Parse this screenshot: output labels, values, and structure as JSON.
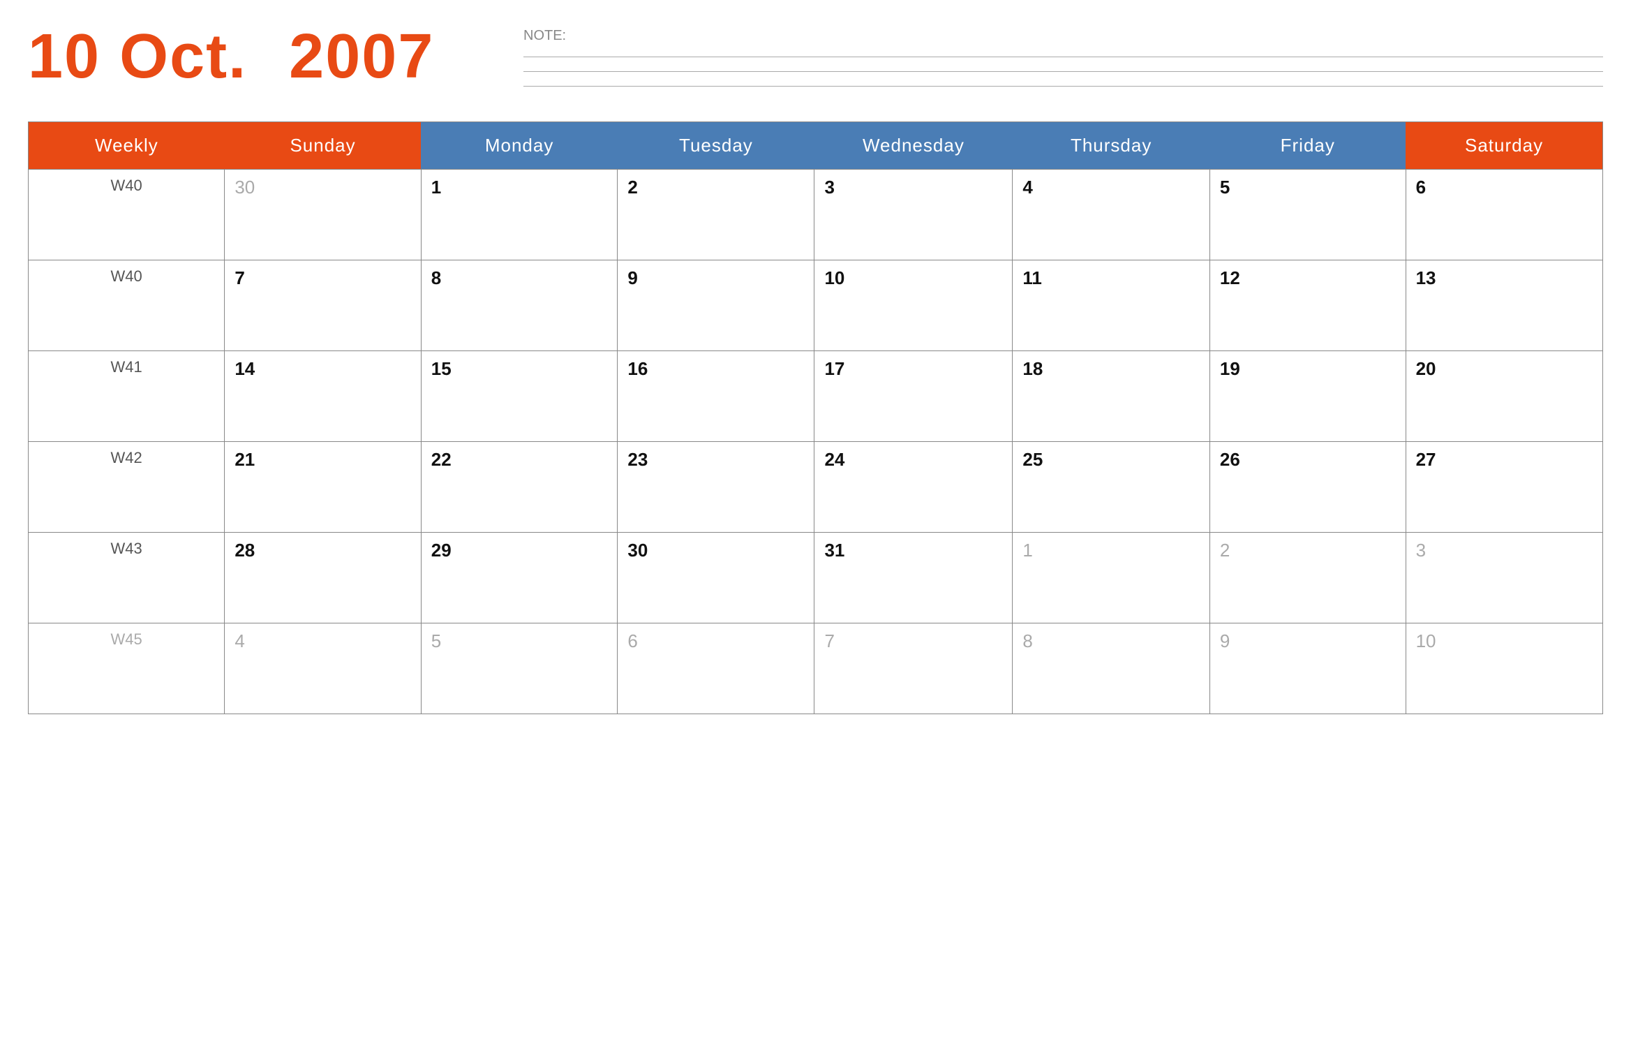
{
  "header": {
    "month_day": "10 Oct.",
    "year": "2007",
    "note_label": "NOTE:"
  },
  "colors": {
    "orange": "#e84a14",
    "blue": "#4a7db5",
    "dim_text": "#aaa",
    "normal_text": "#111"
  },
  "columns": [
    {
      "label": "Weekly",
      "type": "weekly"
    },
    {
      "label": "Sunday",
      "type": "sunday"
    },
    {
      "label": "Monday",
      "type": "weekday"
    },
    {
      "label": "Tuesday",
      "type": "weekday"
    },
    {
      "label": "Wednesday",
      "type": "weekday"
    },
    {
      "label": "Thursday",
      "type": "weekday"
    },
    {
      "label": "Friday",
      "type": "weekday"
    },
    {
      "label": "Saturday",
      "type": "saturday"
    }
  ],
  "rows": [
    {
      "week": "W40",
      "days": [
        {
          "num": "30",
          "dim": true,
          "type": "sunday"
        },
        {
          "num": "1",
          "dim": false,
          "type": "weekday"
        },
        {
          "num": "2",
          "dim": false,
          "type": "weekday"
        },
        {
          "num": "3",
          "dim": false,
          "type": "weekday"
        },
        {
          "num": "4",
          "dim": false,
          "type": "weekday"
        },
        {
          "num": "5",
          "dim": false,
          "type": "weekday"
        },
        {
          "num": "6",
          "dim": false,
          "type": "saturday"
        }
      ]
    },
    {
      "week": "W40",
      "days": [
        {
          "num": "7",
          "dim": false,
          "type": "sunday"
        },
        {
          "num": "8",
          "dim": false,
          "type": "weekday"
        },
        {
          "num": "9",
          "dim": false,
          "type": "weekday"
        },
        {
          "num": "10",
          "dim": false,
          "type": "weekday"
        },
        {
          "num": "11",
          "dim": false,
          "type": "weekday"
        },
        {
          "num": "12",
          "dim": false,
          "type": "weekday"
        },
        {
          "num": "13",
          "dim": false,
          "type": "saturday"
        }
      ]
    },
    {
      "week": "W41",
      "days": [
        {
          "num": "14",
          "dim": false,
          "type": "sunday"
        },
        {
          "num": "15",
          "dim": false,
          "type": "weekday"
        },
        {
          "num": "16",
          "dim": false,
          "type": "weekday"
        },
        {
          "num": "17",
          "dim": false,
          "type": "weekday"
        },
        {
          "num": "18",
          "dim": false,
          "type": "weekday"
        },
        {
          "num": "19",
          "dim": false,
          "type": "weekday"
        },
        {
          "num": "20",
          "dim": false,
          "type": "saturday"
        }
      ]
    },
    {
      "week": "W42",
      "days": [
        {
          "num": "21",
          "dim": false,
          "type": "sunday"
        },
        {
          "num": "22",
          "dim": false,
          "type": "weekday"
        },
        {
          "num": "23",
          "dim": false,
          "type": "weekday"
        },
        {
          "num": "24",
          "dim": false,
          "type": "weekday"
        },
        {
          "num": "25",
          "dim": false,
          "type": "weekday"
        },
        {
          "num": "26",
          "dim": false,
          "type": "weekday"
        },
        {
          "num": "27",
          "dim": false,
          "type": "saturday"
        }
      ]
    },
    {
      "week": "W43",
      "days": [
        {
          "num": "28",
          "dim": false,
          "type": "sunday"
        },
        {
          "num": "29",
          "dim": false,
          "type": "weekday"
        },
        {
          "num": "30",
          "dim": false,
          "type": "weekday"
        },
        {
          "num": "31",
          "dim": false,
          "type": "weekday"
        },
        {
          "num": "1",
          "dim": true,
          "type": "weekday"
        },
        {
          "num": "2",
          "dim": true,
          "type": "weekday"
        },
        {
          "num": "3",
          "dim": true,
          "type": "saturday"
        }
      ]
    },
    {
      "week": "W45",
      "week_dim": true,
      "days": [
        {
          "num": "4",
          "dim": true,
          "type": "sunday"
        },
        {
          "num": "5",
          "dim": true,
          "type": "weekday"
        },
        {
          "num": "6",
          "dim": true,
          "type": "weekday"
        },
        {
          "num": "7",
          "dim": true,
          "type": "weekday"
        },
        {
          "num": "8",
          "dim": true,
          "type": "weekday"
        },
        {
          "num": "9",
          "dim": true,
          "type": "weekday"
        },
        {
          "num": "10",
          "dim": true,
          "type": "saturday"
        }
      ]
    }
  ]
}
